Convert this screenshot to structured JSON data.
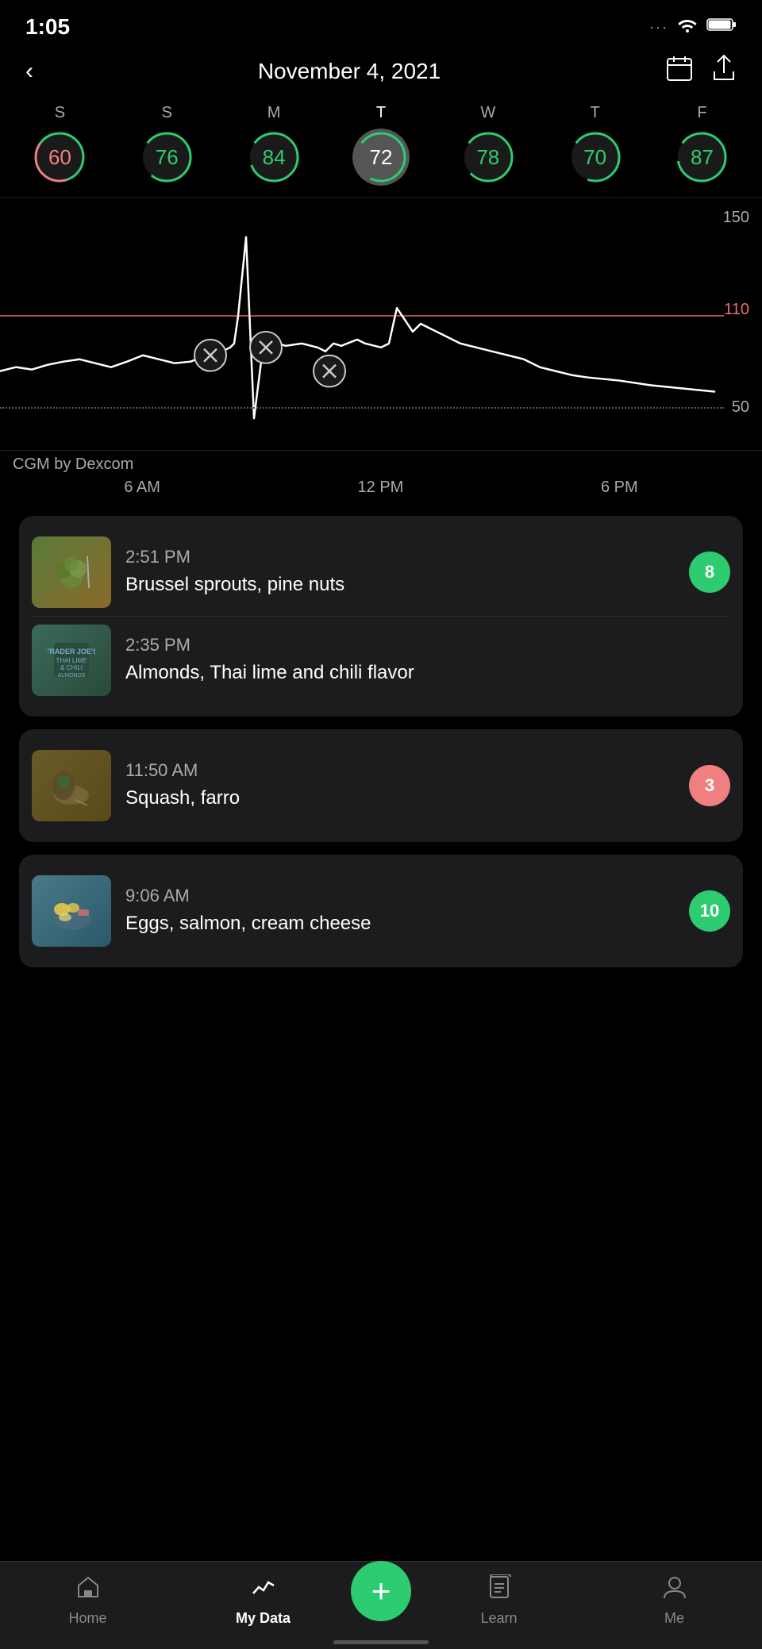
{
  "statusBar": {
    "time": "1:05",
    "dotsLabel": "···",
    "wifiLabel": "📶",
    "batteryLabel": "🔋"
  },
  "header": {
    "backLabel": "‹",
    "title": "November 4, 2021",
    "calendarIcon": "📅",
    "shareIcon": "⬆"
  },
  "weekStrip": {
    "days": [
      {
        "label": "S",
        "number": "60",
        "scoreColor": "#f08080",
        "trailColor": "#2ecc71",
        "isSelected": false
      },
      {
        "label": "S",
        "number": "76",
        "scoreColor": "#2ecc71",
        "trailColor": "#2ecc71",
        "isSelected": false
      },
      {
        "label": "M",
        "number": "84",
        "scoreColor": "#2ecc71",
        "trailColor": "#2ecc71",
        "isSelected": false
      },
      {
        "label": "T",
        "number": "72",
        "scoreColor": "#fff",
        "trailColor": "#2ecc71",
        "isSelected": true
      },
      {
        "label": "W",
        "number": "78",
        "scoreColor": "#2ecc71",
        "trailColor": "#2ecc71",
        "isSelected": false
      },
      {
        "label": "T",
        "number": "70",
        "scoreColor": "#2ecc71",
        "trailColor": "#2ecc71",
        "isSelected": false
      },
      {
        "label": "F",
        "number": "87",
        "scoreColor": "#2ecc71",
        "trailColor": "#2ecc71",
        "isSelected": false
      }
    ]
  },
  "chart": {
    "cgmLabel": "CGM by Dexcom",
    "times": [
      "6 AM",
      "12 PM",
      "6 PM"
    ],
    "valueLabels": [
      "150",
      "110",
      "50"
    ]
  },
  "meals": [
    {
      "items": [
        {
          "time": "2:51 PM",
          "name": "Brussel sprouts, pine nuts",
          "score": "8",
          "scoreType": "green",
          "imageClass": "food-brussel",
          "imageEmoji": "🥦"
        },
        {
          "time": "2:35 PM",
          "name": "Almonds, Thai lime and chili flavor",
          "score": null,
          "scoreType": null,
          "imageClass": "food-almonds",
          "imageEmoji": "🌿"
        }
      ]
    },
    {
      "items": [
        {
          "time": "11:50 AM",
          "name": "Squash, farro",
          "score": "3",
          "scoreType": "pink",
          "imageClass": "food-squash",
          "imageEmoji": "🥘"
        }
      ]
    },
    {
      "items": [
        {
          "time": "9:06 AM",
          "name": "Eggs, salmon, cream cheese",
          "score": "10",
          "scoreType": "green",
          "imageClass": "food-eggs",
          "imageEmoji": "🍳"
        }
      ]
    }
  ],
  "bottomNav": {
    "items": [
      {
        "id": "home",
        "label": "Home",
        "icon": "⌂",
        "active": false
      },
      {
        "id": "mydata",
        "label": "My Data",
        "icon": "⌇",
        "active": true
      },
      {
        "id": "add",
        "label": "",
        "icon": "+",
        "active": false
      },
      {
        "id": "learn",
        "label": "Learn",
        "icon": "📖",
        "active": false
      },
      {
        "id": "me",
        "label": "Me",
        "icon": "👤",
        "active": false
      }
    ]
  }
}
